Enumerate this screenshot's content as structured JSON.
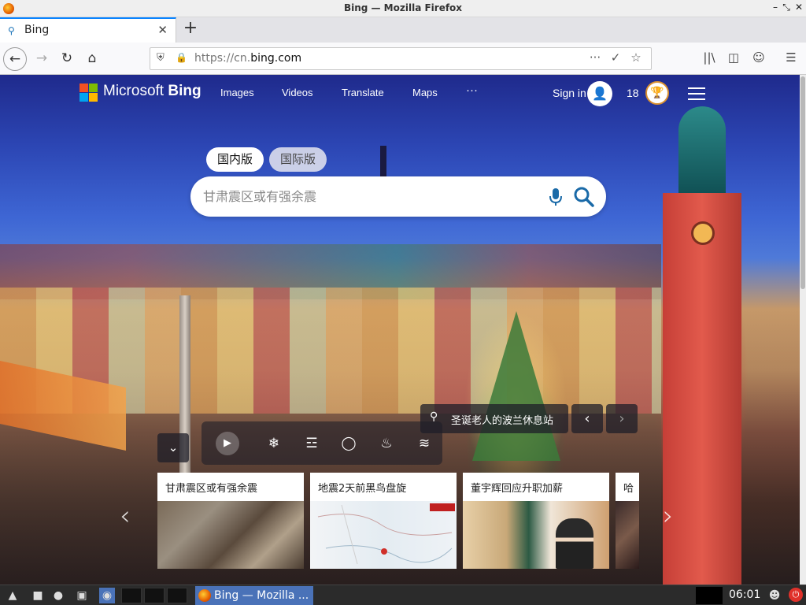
{
  "window": {
    "title": "Bing — Mozilla Firefox",
    "controls": [
      "–",
      "⤡",
      "✕"
    ]
  },
  "tabs": [
    {
      "label": "Bing",
      "active": true
    }
  ],
  "navbar": {
    "url_prefix": "https://cn.",
    "url_domain": "bing.com",
    "icons": [
      "back-icon",
      "forward-icon",
      "reload-icon",
      "home-icon",
      "shield-icon",
      "lock-icon",
      "more-icon",
      "pocket-icon",
      "bookmark-star-icon",
      "library-icon",
      "sidebar-icon",
      "account-icon",
      "menu-icon"
    ]
  },
  "bing": {
    "brand": {
      "prefix": "Microsoft ",
      "name": "Bing"
    },
    "brand_colors": [
      "#f25022",
      "#7fba00",
      "#00a4ef",
      "#ffb900"
    ],
    "nav": [
      "Images",
      "Videos",
      "Translate",
      "Maps",
      "···"
    ],
    "signin_label": "Sign in",
    "reward_points": "18",
    "region_tabs": [
      "国内版",
      "国际版"
    ],
    "search_placeholder": "甘肃震区或有强余震",
    "location_caption": "圣诞老人的波兰休息站",
    "image_nav": [
      "‹",
      "›"
    ],
    "quiz_icons": [
      "play-icon",
      "snowflake-icon",
      "icicles-icon",
      "ornament-icon",
      "fire-icon",
      "wind-icon"
    ],
    "news_cards": [
      {
        "title": "甘肃震区或有强余震",
        "image": "rubble-photo",
        "color": "#6b6050"
      },
      {
        "title": "地震2天前黑鸟盘旋",
        "image": "map-photo",
        "color": "#e9eef2"
      },
      {
        "title": "董宇辉回应升职加薪",
        "image": "studio-photo",
        "color": "#c9a26a"
      },
      {
        "title": "哈",
        "image": "crowd-photo",
        "color": "#4a3a3a"
      }
    ]
  },
  "taskbar": {
    "window_label": "Bing — Mozilla ...",
    "clock": "06:01"
  }
}
